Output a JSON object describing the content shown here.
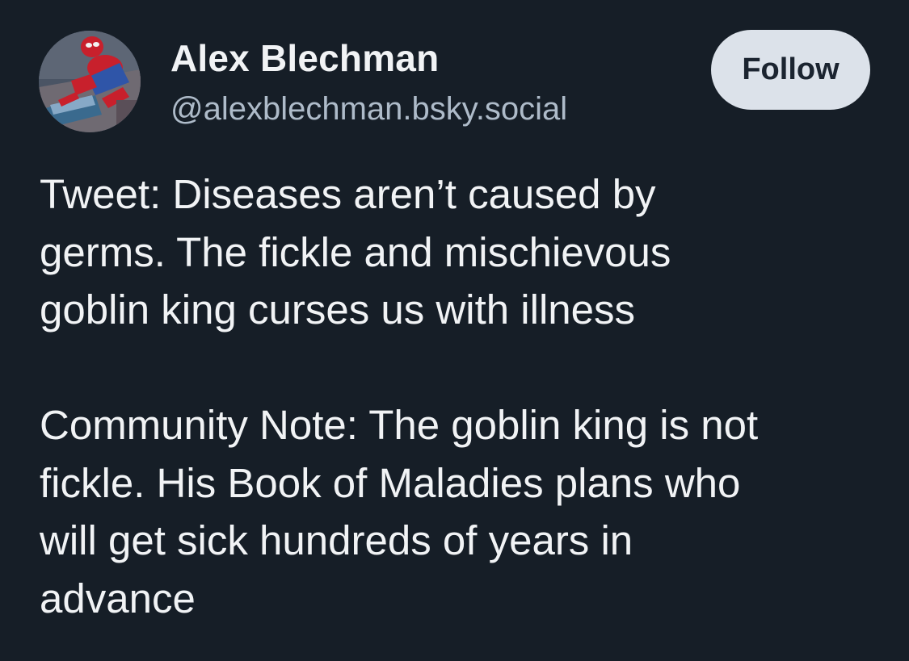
{
  "author": {
    "display_name": "Alex Blechman",
    "handle": "@alexblechman.bsky.social",
    "avatar_icon": "spider-man-avatar"
  },
  "actions": {
    "follow_label": "Follow"
  },
  "post": {
    "paragraphs": [
      {
        "lines": [
          "Tweet: Diseases aren’t caused by",
          "germs. The fickle and mischievous",
          "goblin king curses us with illness"
        ]
      },
      {
        "lines": [
          "Community Note: The goblin king is not",
          "fickle. His Book of Maladies plans who",
          "will get sick hundreds of years in",
          "advance"
        ]
      }
    ]
  },
  "colors": {
    "background": "#161e27",
    "text": "#f1f3f5",
    "handle": "#aebbc9",
    "follow_button_bg": "#dce2ea",
    "follow_button_text": "#1b2430"
  }
}
